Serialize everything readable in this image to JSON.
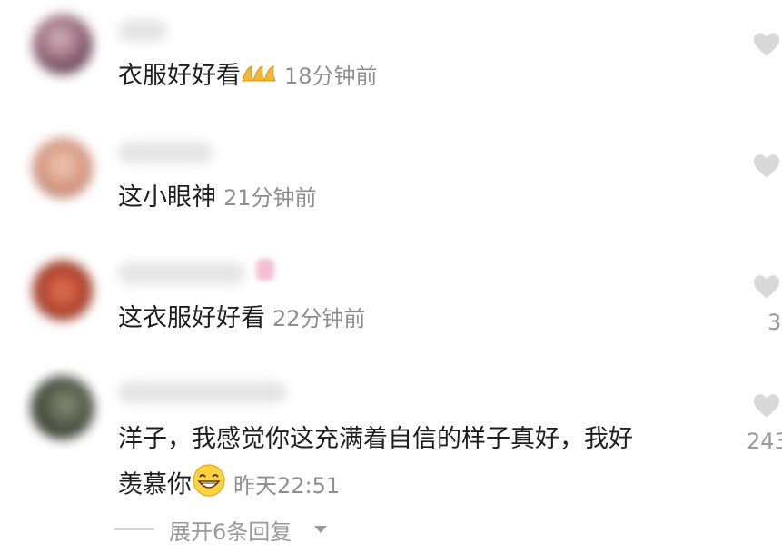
{
  "comments": [
    {
      "text": "衣服好好看",
      "emoji": "clap-emoji",
      "time": "18分钟前",
      "likes": ""
    },
    {
      "text": "这小眼神",
      "time": "21分钟前",
      "likes": ""
    },
    {
      "text": "这衣服好好看",
      "time": "22分钟前",
      "likes": "3"
    },
    {
      "line1": "洋子，我感觉你这充满着自信的样子真好，我好",
      "line2": "羡慕你",
      "emoji": "grin-emoji",
      "time": "昨天22:51",
      "likes": "243"
    }
  ],
  "expand_replies": "展开6条回复",
  "icons": [
    "heart-icon",
    "chevron-down-icon",
    "clap-emoji",
    "grin-emoji"
  ],
  "colors": {
    "text": "#1e1e1e",
    "meta": "#8e8e8e",
    "heart": "#d9d9d9"
  }
}
